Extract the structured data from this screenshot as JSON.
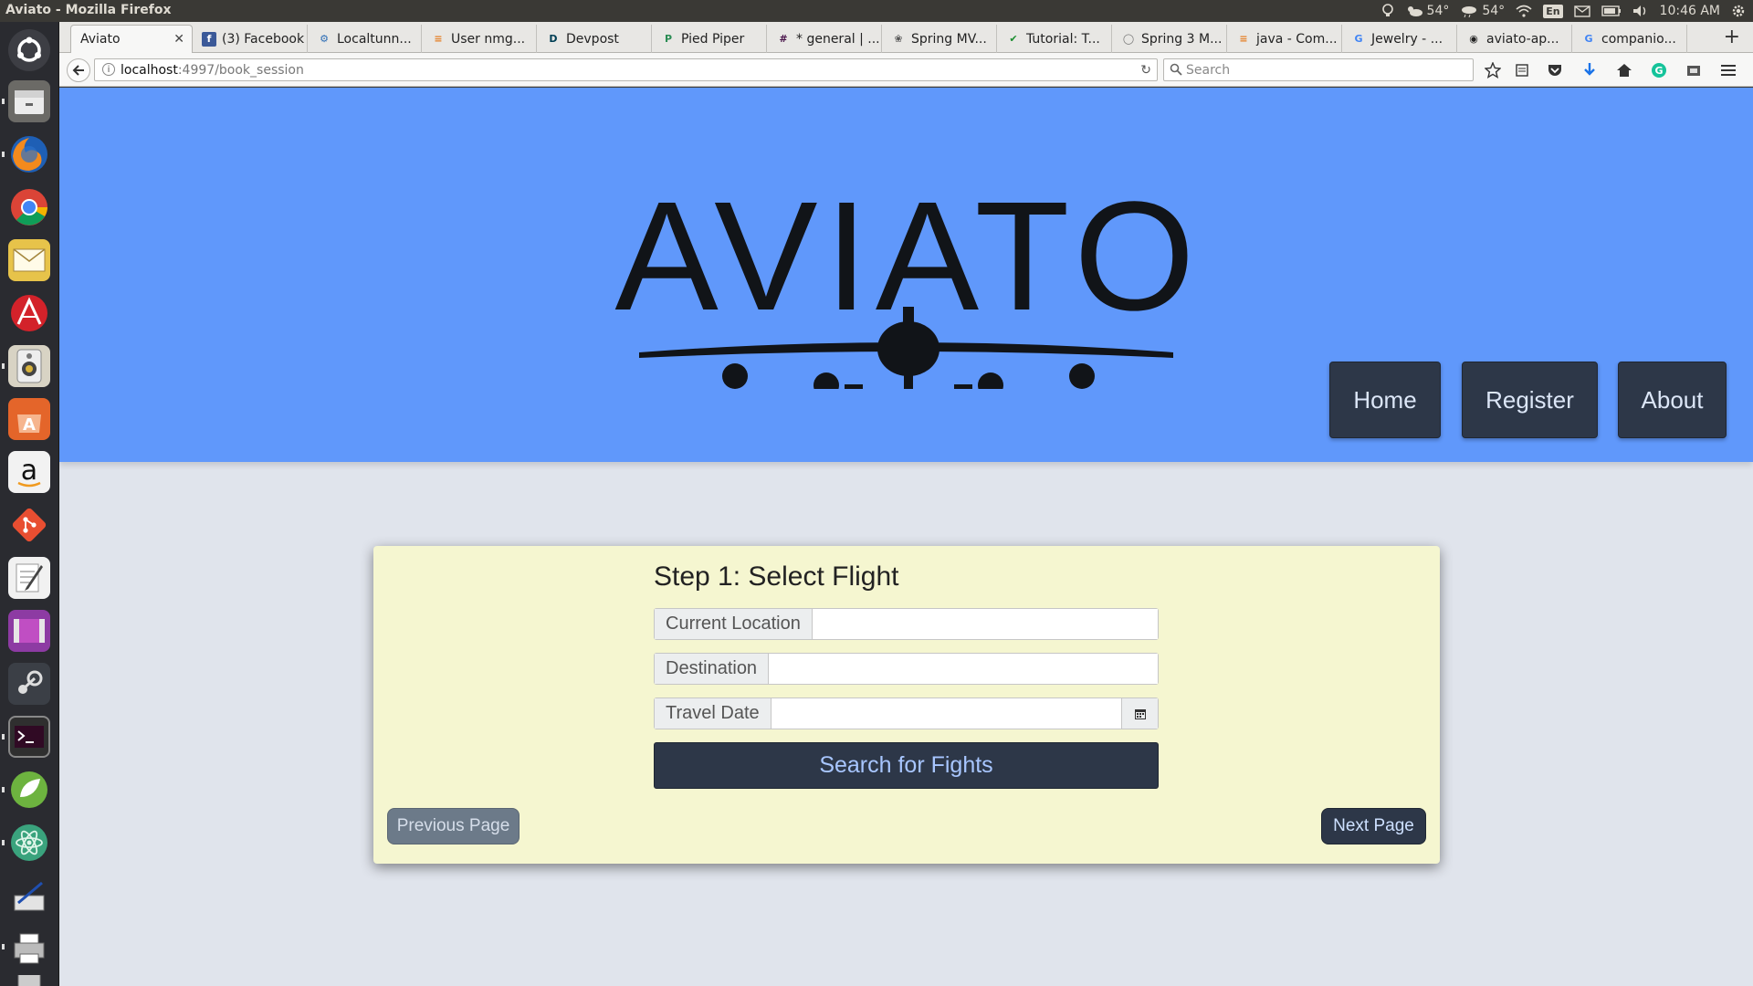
{
  "os_panel": {
    "window_title": "Aviato - Mozilla Firefox",
    "weather1": "54°",
    "weather2": "54°",
    "keyboard": "En",
    "clock": "10:46 AM"
  },
  "browser": {
    "tabs": [
      {
        "label": "Aviato",
        "icon": "none",
        "active": true
      },
      {
        "label": "(3) Facebook",
        "icon": "facebook-icon"
      },
      {
        "label": "Localtunn...",
        "icon": "localtunnel-icon"
      },
      {
        "label": "User nmg...",
        "icon": "stackoverflow-icon"
      },
      {
        "label": "Devpost",
        "icon": "devpost-icon"
      },
      {
        "label": "Pied Piper",
        "icon": "piedpiper-icon"
      },
      {
        "label": "* general | ...",
        "icon": "slack-icon"
      },
      {
        "label": "Spring MV...",
        "icon": "spring-icon"
      },
      {
        "label": "Tutorial: T...",
        "icon": "check-icon"
      },
      {
        "label": "Spring 3 M...",
        "icon": "spring-icon"
      },
      {
        "label": "java - Com...",
        "icon": "stackoverflow-icon"
      },
      {
        "label": "Jewelry - ...",
        "icon": "google-icon"
      },
      {
        "label": "aviato-ap...",
        "icon": "github-icon"
      },
      {
        "label": "companio...",
        "icon": "google-icon"
      }
    ],
    "url_host": "localhost",
    "url_rest": ":4997/book_session",
    "search_placeholder": "Search"
  },
  "site": {
    "logo_text": "AVIATO",
    "nav": {
      "home": "Home",
      "register": "Register",
      "about": "About"
    },
    "colors": {
      "hero": "#6098fb",
      "dark_button": "#2d3748",
      "card": "#f5f6d0",
      "page_bg": "#e0e4ec"
    }
  },
  "booking": {
    "title": "Step 1: Select Flight",
    "current_location_label": "Current Location",
    "current_location_value": "",
    "destination_label": "Destination",
    "destination_value": "",
    "travel_date_label": "Travel Date",
    "travel_date_value": "",
    "search_button": "Search for Fights",
    "prev_button": "Previous Page",
    "next_button": "Next Page"
  }
}
